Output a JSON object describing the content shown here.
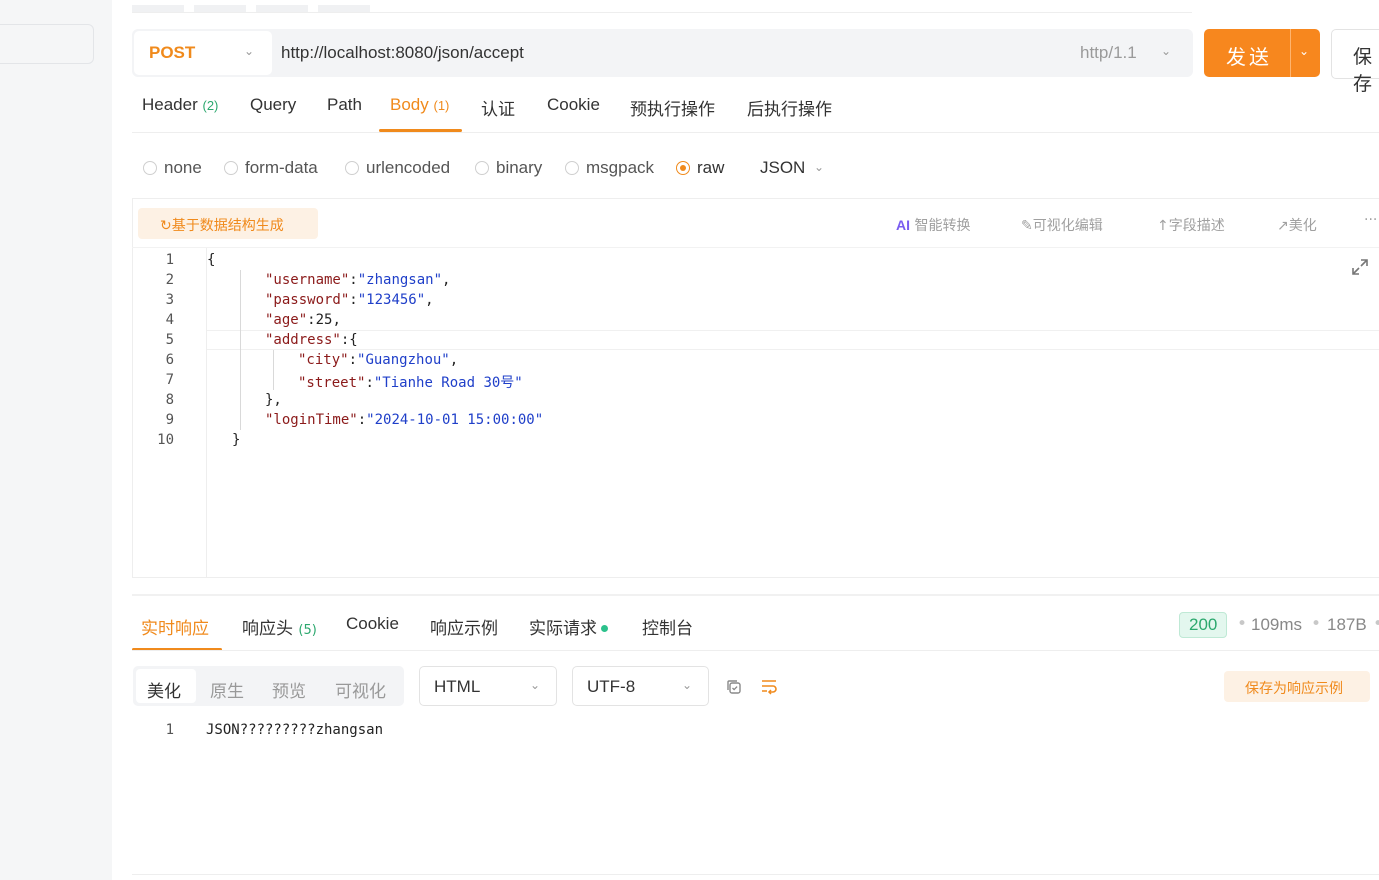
{
  "request": {
    "method": "POST",
    "url": "http://localhost:8080/json/accept",
    "protocol": "http/1.1",
    "send_label": "发送",
    "save_label": "保存"
  },
  "request_tabs": [
    {
      "label": "Header",
      "count": "(2)"
    },
    {
      "label": "Query",
      "count": ""
    },
    {
      "label": "Path",
      "count": ""
    },
    {
      "label": "Body",
      "count": "(1)"
    },
    {
      "label": "认证",
      "count": ""
    },
    {
      "label": "Cookie",
      "count": ""
    },
    {
      "label": "预执行操作",
      "count": ""
    },
    {
      "label": "后执行操作",
      "count": ""
    }
  ],
  "active_request_tab": "Body",
  "body_types": [
    "none",
    "form-data",
    "urlencoded",
    "binary",
    "msgpack",
    "raw"
  ],
  "selected_body_type": "raw",
  "raw_format": "JSON",
  "editor_toolbar": {
    "generate_label": "基于数据结构生成",
    "ai_mark": "AI",
    "ai_label": "智能转换",
    "visual_edit_label": "可视化编辑",
    "field_desc_label": "字段描述",
    "beautify_label": "美化",
    "more_label": "···"
  },
  "code_lines": [
    {
      "n": "1",
      "parts": [
        {
          "c": "n",
          "t": "{"
        }
      ]
    },
    {
      "n": "2",
      "parts": [
        {
          "c": "k",
          "t": "\"username\""
        },
        {
          "c": "n",
          "t": ":"
        },
        {
          "c": "s",
          "t": "\"zhangsan\""
        },
        {
          "c": "n",
          "t": ","
        }
      ]
    },
    {
      "n": "3",
      "parts": [
        {
          "c": "k",
          "t": "\"password\""
        },
        {
          "c": "n",
          "t": ":"
        },
        {
          "c": "s",
          "t": "\"123456\""
        },
        {
          "c": "n",
          "t": ","
        }
      ]
    },
    {
      "n": "4",
      "parts": [
        {
          "c": "k",
          "t": "\"age\""
        },
        {
          "c": "n",
          "t": ":25,"
        }
      ]
    },
    {
      "n": "5",
      "parts": [
        {
          "c": "k",
          "t": "\"address\""
        },
        {
          "c": "n",
          "t": ":{"
        }
      ]
    },
    {
      "n": "6",
      "parts": [
        {
          "c": "k",
          "t": "\"city\""
        },
        {
          "c": "n",
          "t": ":"
        },
        {
          "c": "s",
          "t": "\"Guangzhou\""
        },
        {
          "c": "n",
          "t": ","
        }
      ]
    },
    {
      "n": "7",
      "parts": [
        {
          "c": "k",
          "t": "\"street\""
        },
        {
          "c": "n",
          "t": ":"
        },
        {
          "c": "s",
          "t": "\"Tianhe Road 30号\""
        }
      ]
    },
    {
      "n": "8",
      "parts": [
        {
          "c": "n",
          "t": "},"
        }
      ]
    },
    {
      "n": "9",
      "parts": [
        {
          "c": "k",
          "t": "\"loginTime\""
        },
        {
          "c": "n",
          "t": ":"
        },
        {
          "c": "s",
          "t": "\"2024-10-01 15:00:00\""
        }
      ]
    },
    {
      "n": "10",
      "parts": [
        {
          "c": "n",
          "t": "}"
        }
      ]
    }
  ],
  "response_tabs": [
    {
      "label": "实时响应",
      "count": ""
    },
    {
      "label": "响应头",
      "count": "(5)"
    },
    {
      "label": "Cookie",
      "count": ""
    },
    {
      "label": "响应示例",
      "count": ""
    },
    {
      "label": "实际请求",
      "count": ""
    },
    {
      "label": "控制台",
      "count": ""
    }
  ],
  "active_response_tab": "实时响应",
  "response_meta": {
    "status": "200",
    "time": "109ms",
    "size": "187B",
    "separator": "•"
  },
  "view_modes": [
    "美化",
    "原生",
    "预览",
    "可视化"
  ],
  "selected_view_mode": "美化",
  "content_type": "HTML",
  "encoding": "UTF-8",
  "save_example_label": "保存为响应示例",
  "response_lines": [
    {
      "n": "1",
      "text": "JSON?????????zhangsan"
    }
  ],
  "colors": {
    "accent": "#f08a1c",
    "send_button": "#f7871e",
    "success": "#2ca86e"
  }
}
